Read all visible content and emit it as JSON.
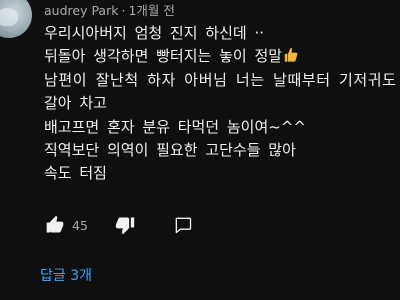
{
  "comment": {
    "author": "audrey Park",
    "separator": "·",
    "time_ago": "1개월 전",
    "lines": [
      "우리시아버지 엄청  진지 하신데 ··",
      "뒤돌아  생각하면  빵터지는  놓이 정말",
      "남편이 잘난척 하자  아버님  너는 날때부터  기저귀도 ",
      "갈아 차고",
      "배고프면  혼자 분유 타먹던 놈이여~^^",
      "직역보단 의역이 필요한  고단수들  많아",
      "속도 터짐"
    ],
    "line2_emoji": "thumbs-up-emoji"
  },
  "actions": {
    "like_icon": "thumbs-up-icon",
    "like_count": "45",
    "dislike_icon": "thumbs-down-icon",
    "reply_icon": "reply-bubble-icon"
  },
  "replies": {
    "label": "답글 3개"
  },
  "colors": {
    "background": "#0f0f0f",
    "text": "#f1f1f1",
    "meta": "#aaaaaa",
    "link": "#3ea6ff"
  }
}
